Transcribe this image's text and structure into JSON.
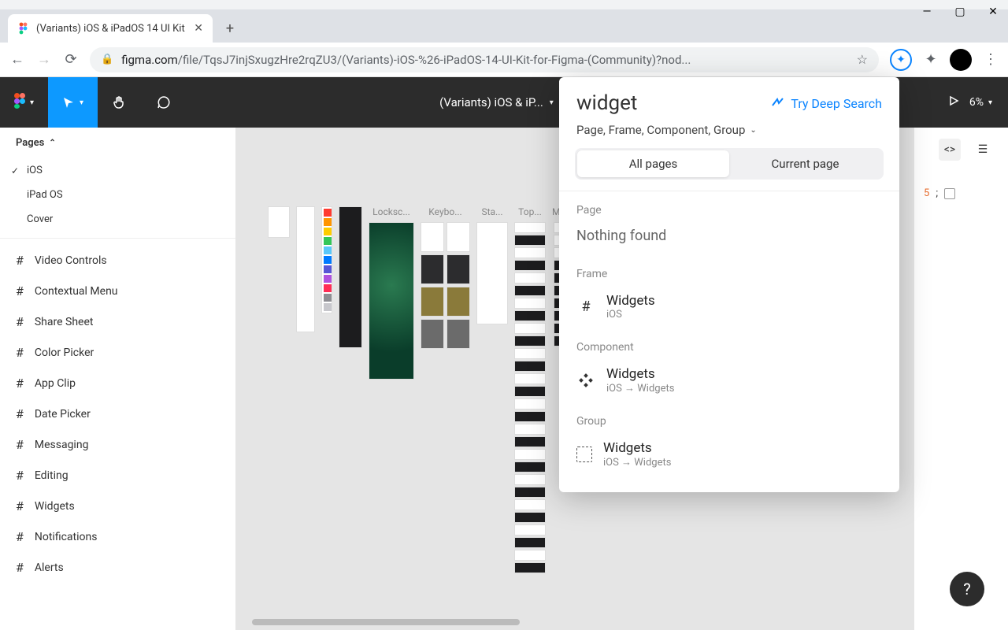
{
  "window": {
    "tab_title": "(Variants) iOS & iPadOS 14 UI Kit",
    "url_display_prefix": "figma.com",
    "url_display_path": "/file/TqsJ7injSxugzHre2rqZU3/(Variants)-iOS-%26-iPadOS-14-UI-Kit-for-Figma-(Community)?nod..."
  },
  "figma": {
    "doc_title": "(Variants) iOS & iP...",
    "zoom": "6%",
    "pages_label": "Pages",
    "pages": [
      {
        "name": "iOS",
        "active": true
      },
      {
        "name": "iPad OS",
        "active": false
      },
      {
        "name": "Cover",
        "active": false
      }
    ],
    "layers": [
      "Video Controls",
      "Contextual Menu",
      "Share Sheet",
      "Color Picker",
      "App Clip",
      "Date Picker",
      "Messaging",
      "Editing",
      "Widgets",
      "Notifications",
      "Alerts"
    ],
    "artboard_labels": [
      "Locksc...",
      "Keybo...",
      "Sta...",
      "Top...",
      "Menu..."
    ],
    "right_code_num": "5",
    "right_code_suffix": ";"
  },
  "popover": {
    "query": "widget",
    "deep_search": "Try Deep Search",
    "filters_line": "Page, Frame, Component, Group",
    "seg_all": "All pages",
    "seg_current": "Current page",
    "labels": {
      "page": "Page",
      "frame": "Frame",
      "component": "Component",
      "group": "Group"
    },
    "nothing": "Nothing found",
    "results": {
      "frame": {
        "title": "Widgets",
        "path": "iOS"
      },
      "component": {
        "title": "Widgets",
        "path": "iOS → Widgets"
      },
      "group": {
        "title": "Widgets",
        "path": "iOS → Widgets"
      }
    }
  }
}
